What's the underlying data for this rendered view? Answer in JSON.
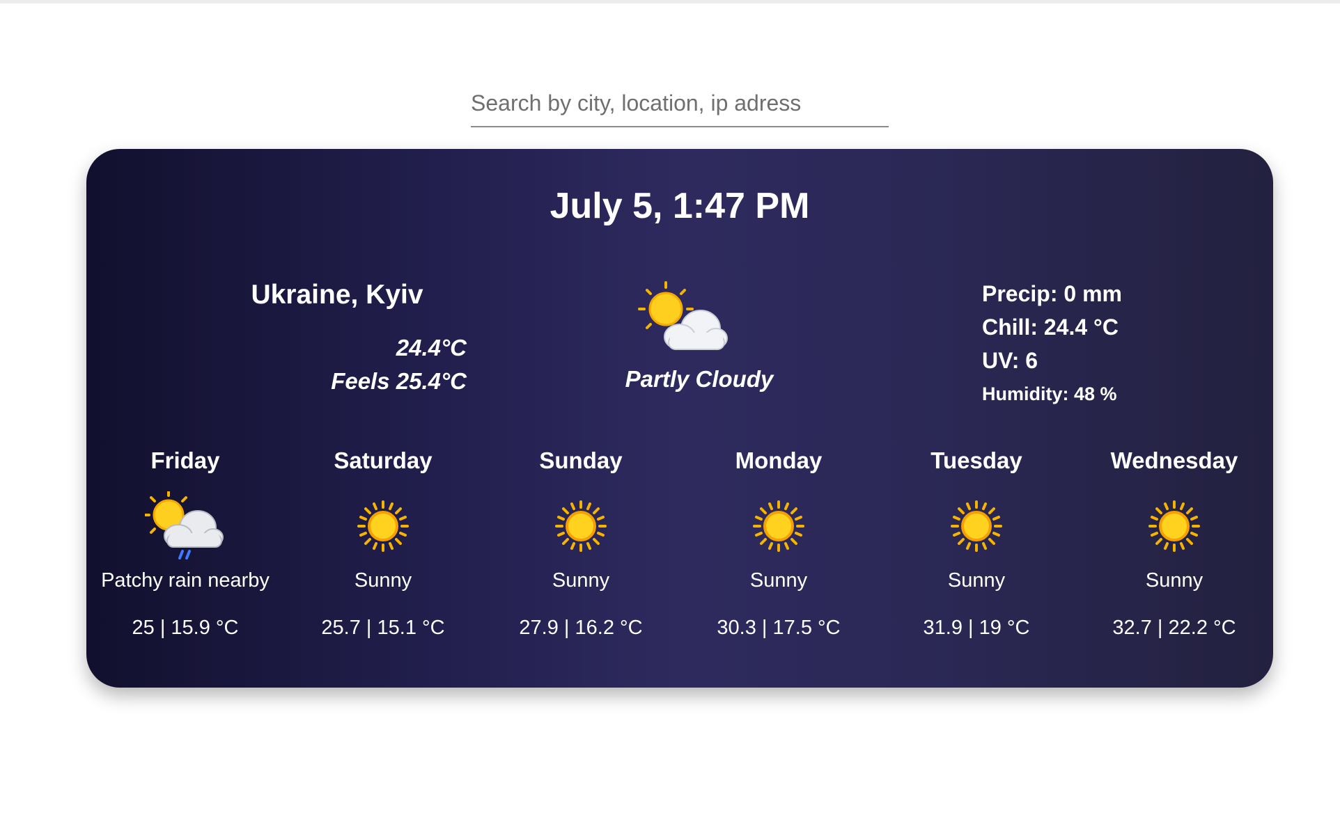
{
  "search": {
    "placeholder": "Search by city, location, ip adress"
  },
  "current": {
    "datetime": "July 5, 1:47 PM",
    "location": "Ukraine, Kyiv",
    "temperature": "24.4°C",
    "feels_like": "Feels 25.4°C",
    "condition": "Partly Cloudy",
    "icon": "partly-cloudy-icon",
    "precip": "Precip: 0 mm",
    "chill": "Chill: 24.4 °C",
    "uv": "UV: 6",
    "humidity": "Humidity: 48 %"
  },
  "forecast": [
    {
      "day": "Friday",
      "condition": "Patchy rain nearby",
      "icon": "patchy-rain-icon",
      "temps": "25 | 15.9 °C"
    },
    {
      "day": "Saturday",
      "condition": "Sunny",
      "icon": "sun-icon",
      "temps": "25.7 | 15.1 °C"
    },
    {
      "day": "Sunday",
      "condition": "Sunny",
      "icon": "sun-icon",
      "temps": "27.9 | 16.2 °C"
    },
    {
      "day": "Monday",
      "condition": "Sunny",
      "icon": "sun-icon",
      "temps": "30.3 | 17.5 °C"
    },
    {
      "day": "Tuesday",
      "condition": "Sunny",
      "icon": "sun-icon",
      "temps": "31.9 | 19 °C"
    },
    {
      "day": "Wednesday",
      "condition": "Sunny",
      "icon": "sun-icon",
      "temps": "32.7 | 22.2 °C"
    }
  ],
  "colors": {
    "card_dark": "#12102e",
    "card_mid": "#2e2a5e",
    "sun": "#ffd21f",
    "cloud": "#f1f3f6",
    "rain": "#3d7bff"
  }
}
